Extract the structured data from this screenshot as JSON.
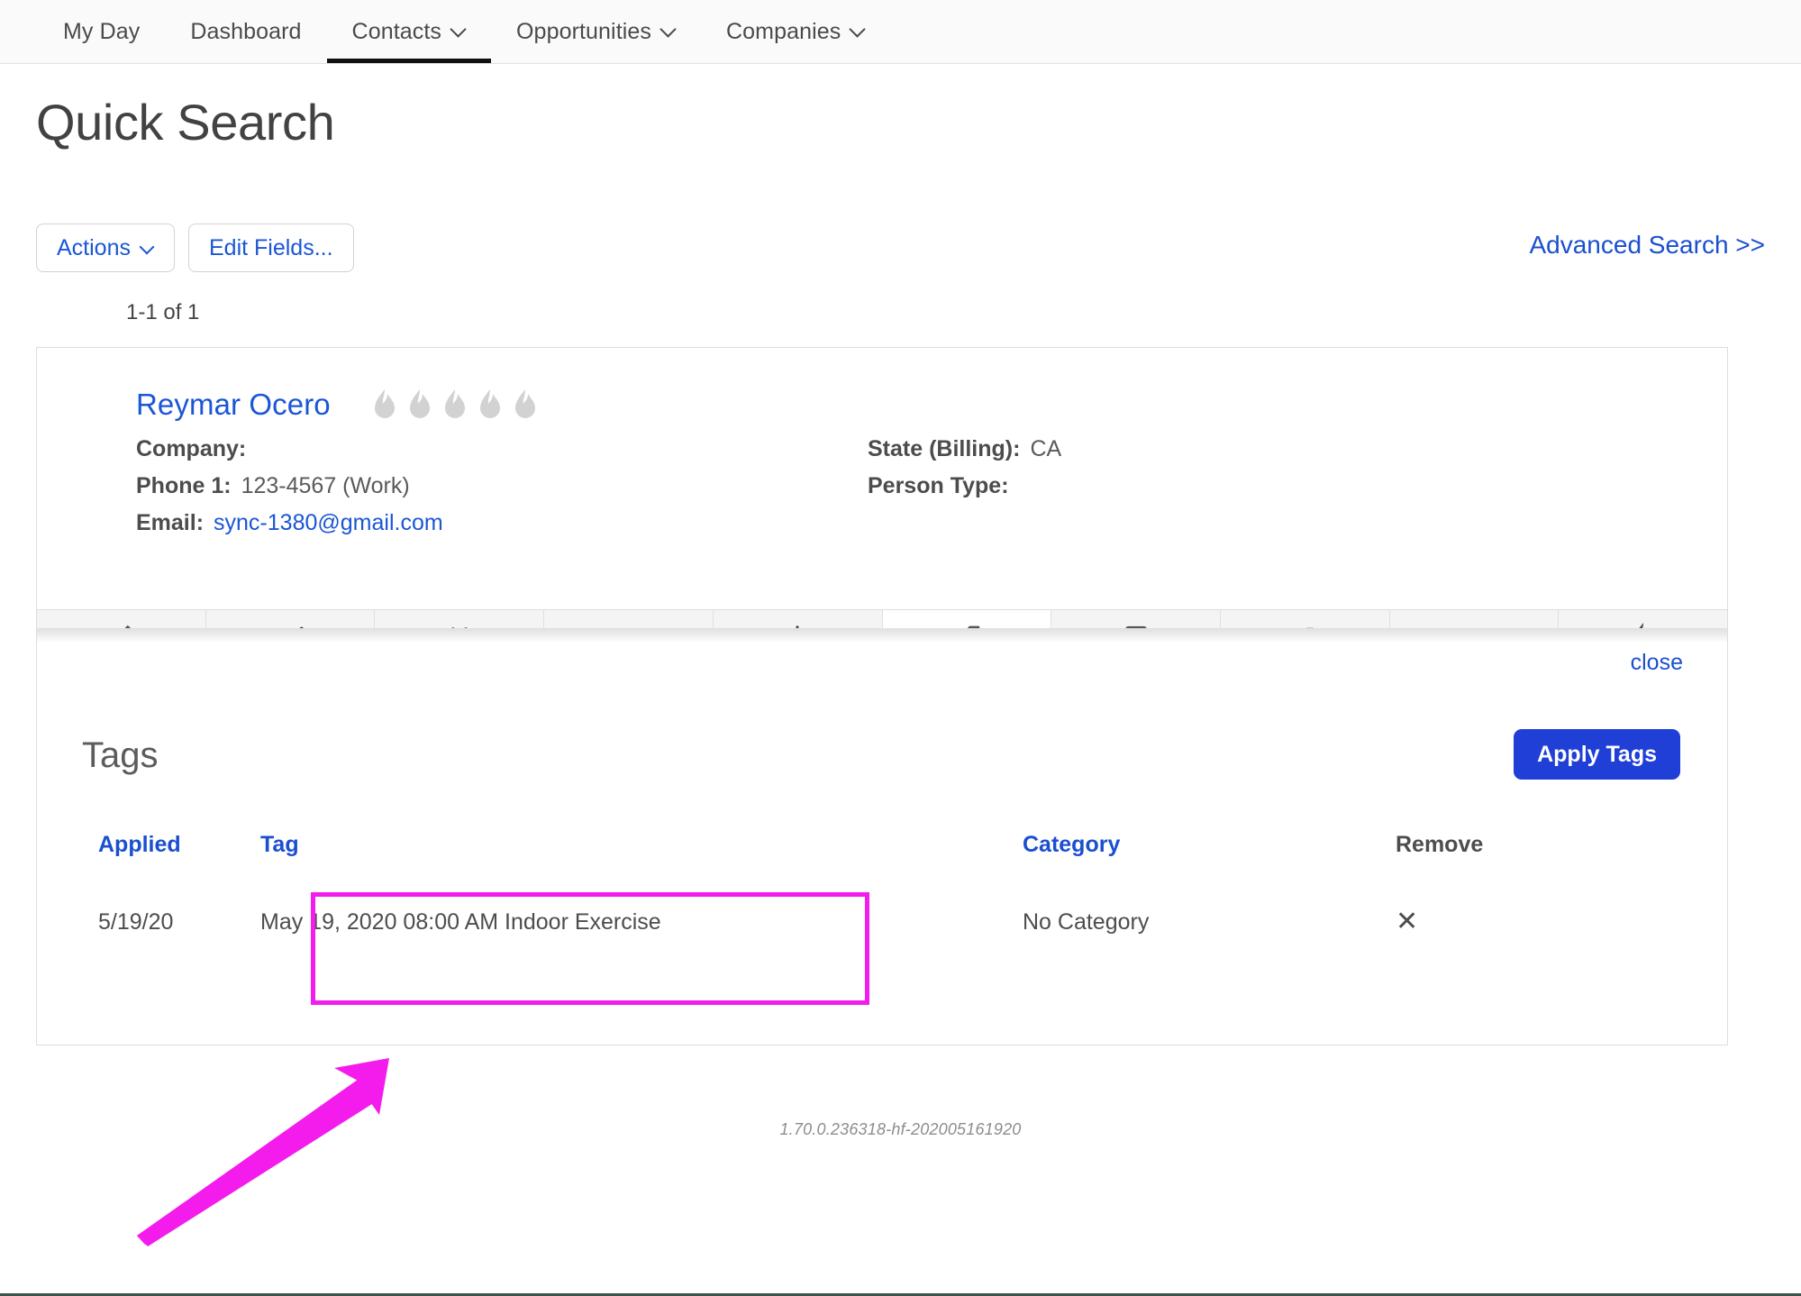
{
  "nav": {
    "items": [
      {
        "label": "My Day",
        "has_caret": false,
        "active": false
      },
      {
        "label": "Dashboard",
        "has_caret": false,
        "active": false
      },
      {
        "label": "Contacts",
        "has_caret": true,
        "active": true
      },
      {
        "label": "Opportunities",
        "has_caret": true,
        "active": false
      },
      {
        "label": "Companies",
        "has_caret": true,
        "active": false
      }
    ]
  },
  "page": {
    "title": "Quick Search",
    "actions_label": "Actions",
    "edit_fields_label": "Edit Fields...",
    "advanced_search_label": "Advanced Search >>",
    "result_count": "1-1 of 1"
  },
  "record": {
    "name": "Reymar Ocero",
    "flame_rating": 5,
    "flame_color": "#d2d2d2",
    "left_fields": [
      {
        "label": "Company:",
        "value": "",
        "is_link": false
      },
      {
        "label": "Phone 1:",
        "value": "123-4567 (Work)",
        "is_link": false
      },
      {
        "label": "Email:",
        "value": "sync-1380@gmail.com",
        "is_link": true
      }
    ],
    "right_fields": [
      {
        "label": "State (Billing):",
        "value": "CA",
        "is_link": false
      },
      {
        "label": "Person Type:",
        "value": "",
        "is_link": false
      }
    ],
    "icon_tabs": [
      {
        "name": "note-edit-icon",
        "active": false
      },
      {
        "name": "check-task-icon",
        "active": false
      },
      {
        "name": "calendar-icon",
        "active": false
      },
      {
        "name": "envelope-email-icon",
        "active": false
      },
      {
        "name": "dollar-icon",
        "active": false
      },
      {
        "name": "tag-icon",
        "active": true
      },
      {
        "name": "invoice-document-icon",
        "active": false
      },
      {
        "name": "campaign-flow-icon",
        "active": false
      },
      {
        "name": "price-tag-dollar-icon",
        "active": false
      },
      {
        "name": "flame-icon",
        "active": false
      }
    ]
  },
  "tags_panel": {
    "close_label": "close",
    "heading": "Tags",
    "apply_button_label": "Apply Tags",
    "apply_button_color": "#1f3fd6",
    "columns": [
      {
        "label": "Applied",
        "sortable": true
      },
      {
        "label": "Tag",
        "sortable": true
      },
      {
        "label": "Category",
        "sortable": true
      },
      {
        "label": "Remove",
        "sortable": false
      }
    ],
    "rows": [
      {
        "applied": "5/19/20",
        "tag": "May 19, 2020 08:00 AM Indoor Exercise",
        "category": "No Category",
        "remove_glyph": "✕"
      }
    ]
  },
  "footer": {
    "version": "1.70.0.236318-hf-202005161920"
  },
  "annotations": {
    "highlight_color": "#f41ced",
    "arrow_color": "#f41ced",
    "highlight_target": "tag-cell",
    "arrow_points_to": "tag-cell"
  }
}
